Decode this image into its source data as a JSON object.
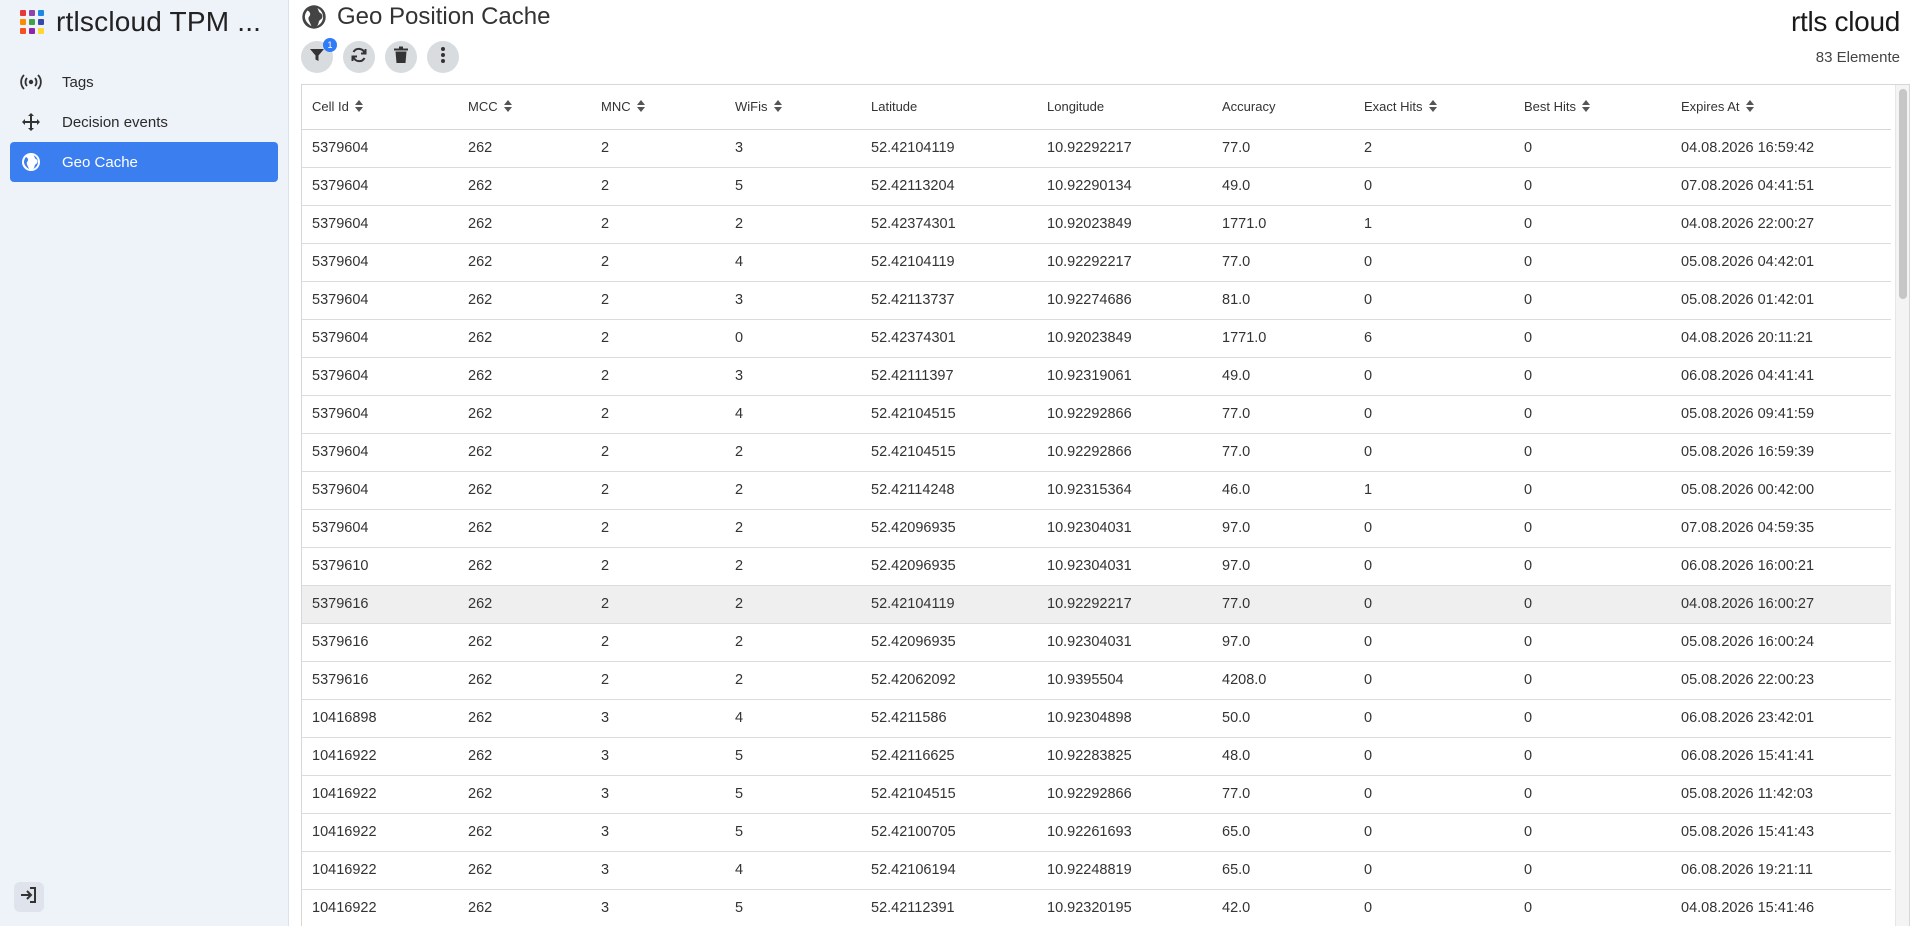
{
  "app": {
    "title": "rtlscloud TPM ...",
    "grid_colors": [
      "#e53935",
      "#8e44ad",
      "#1e88e5",
      "#fb8c00",
      "#43a047",
      "#3949ab",
      "#f4511e",
      "#8e24aa",
      "#fdd835"
    ]
  },
  "sidebar": {
    "items": [
      {
        "label": "Tags",
        "icon": "broadcast-icon"
      },
      {
        "label": "Decision events",
        "icon": "move-arrows-icon"
      },
      {
        "label": "Geo Cache",
        "icon": "globe-icon",
        "active": true
      }
    ],
    "logout_icon": "logout-icon"
  },
  "header": {
    "title": "Geo Position Cache",
    "brand": "rtls cloud",
    "count": "83 Elemente",
    "filter_badge": "1"
  },
  "colors": {
    "accent": "#3a7ef0",
    "badge": "#2f7cf6"
  },
  "table": {
    "columns": [
      "Cell Id",
      "MCC",
      "MNC",
      "WiFis",
      "Latitude",
      "Longitude",
      "Accuracy",
      "Exact Hits",
      "Best Hits",
      "Expires At"
    ],
    "sortable": [
      true,
      true,
      true,
      true,
      false,
      false,
      false,
      true,
      true,
      true
    ],
    "rows": [
      [
        "5379604",
        "262",
        "2",
        "3",
        "52.42104119",
        "10.92292217",
        "77.0",
        "2",
        "0",
        "04.08.2026 16:59:42"
      ],
      [
        "5379604",
        "262",
        "2",
        "5",
        "52.42113204",
        "10.92290134",
        "49.0",
        "0",
        "0",
        "07.08.2026 04:41:51"
      ],
      [
        "5379604",
        "262",
        "2",
        "2",
        "52.42374301",
        "10.92023849",
        "1771.0",
        "1",
        "0",
        "04.08.2026 22:00:27"
      ],
      [
        "5379604",
        "262",
        "2",
        "4",
        "52.42104119",
        "10.92292217",
        "77.0",
        "0",
        "0",
        "05.08.2026 04:42:01"
      ],
      [
        "5379604",
        "262",
        "2",
        "3",
        "52.42113737",
        "10.92274686",
        "81.0",
        "0",
        "0",
        "05.08.2026 01:42:01"
      ],
      [
        "5379604",
        "262",
        "2",
        "0",
        "52.42374301",
        "10.92023849",
        "1771.0",
        "6",
        "0",
        "04.08.2026 20:11:21"
      ],
      [
        "5379604",
        "262",
        "2",
        "3",
        "52.42111397",
        "10.92319061",
        "49.0",
        "0",
        "0",
        "06.08.2026 04:41:41"
      ],
      [
        "5379604",
        "262",
        "2",
        "4",
        "52.42104515",
        "10.92292866",
        "77.0",
        "0",
        "0",
        "05.08.2026 09:41:59"
      ],
      [
        "5379604",
        "262",
        "2",
        "2",
        "52.42104515",
        "10.92292866",
        "77.0",
        "0",
        "0",
        "05.08.2026 16:59:39"
      ],
      [
        "5379604",
        "262",
        "2",
        "2",
        "52.42114248",
        "10.92315364",
        "46.0",
        "1",
        "0",
        "05.08.2026 00:42:00"
      ],
      [
        "5379604",
        "262",
        "2",
        "2",
        "52.42096935",
        "10.92304031",
        "97.0",
        "0",
        "0",
        "07.08.2026 04:59:35"
      ],
      [
        "5379610",
        "262",
        "2",
        "2",
        "52.42096935",
        "10.92304031",
        "97.0",
        "0",
        "0",
        "06.08.2026 16:00:21"
      ],
      [
        "5379616",
        "262",
        "2",
        "2",
        "52.42104119",
        "10.92292217",
        "77.0",
        "0",
        "0",
        "04.08.2026 16:00:27"
      ],
      [
        "5379616",
        "262",
        "2",
        "2",
        "52.42096935",
        "10.92304031",
        "97.0",
        "0",
        "0",
        "05.08.2026 16:00:24"
      ],
      [
        "5379616",
        "262",
        "2",
        "2",
        "52.42062092",
        "10.9395504",
        "4208.0",
        "0",
        "0",
        "05.08.2026 22:00:23"
      ],
      [
        "10416898",
        "262",
        "3",
        "4",
        "52.4211586",
        "10.92304898",
        "50.0",
        "0",
        "0",
        "06.08.2026 23:42:01"
      ],
      [
        "10416922",
        "262",
        "3",
        "5",
        "52.42116625",
        "10.92283825",
        "48.0",
        "0",
        "0",
        "06.08.2026 15:41:41"
      ],
      [
        "10416922",
        "262",
        "3",
        "5",
        "52.42104515",
        "10.92292866",
        "77.0",
        "0",
        "0",
        "05.08.2026 11:42:03"
      ],
      [
        "10416922",
        "262",
        "3",
        "5",
        "52.42100705",
        "10.92261693",
        "65.0",
        "0",
        "0",
        "05.08.2026 15:41:43"
      ],
      [
        "10416922",
        "262",
        "3",
        "4",
        "52.42106194",
        "10.92248819",
        "65.0",
        "0",
        "0",
        "06.08.2026 19:21:11"
      ],
      [
        "10416922",
        "262",
        "3",
        "5",
        "52.42112391",
        "10.92320195",
        "42.0",
        "0",
        "0",
        "04.08.2026 15:41:46"
      ]
    ],
    "highlighted_row": 12
  }
}
